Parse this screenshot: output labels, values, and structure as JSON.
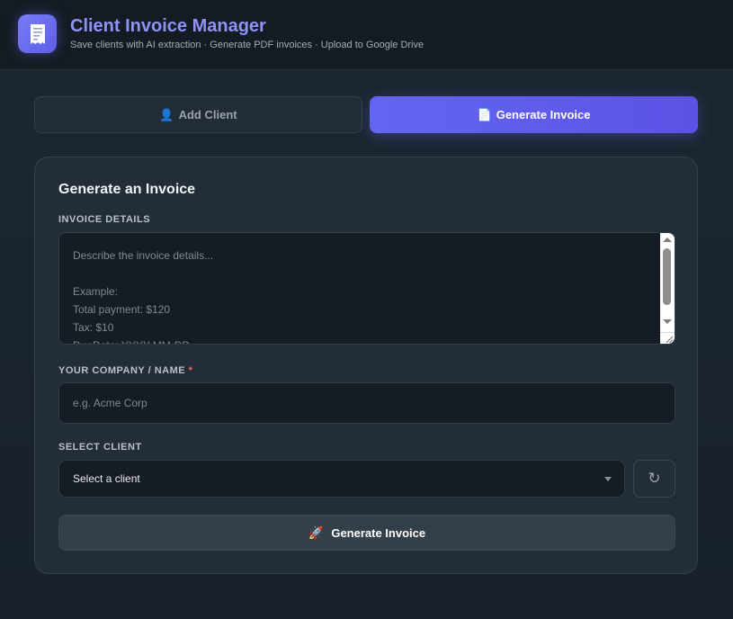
{
  "header": {
    "title": "Client Invoice Manager",
    "subtitle": "Save clients with AI extraction · Generate PDF invoices · Upload to Google Drive",
    "logo_icon": "receipt-icon"
  },
  "tabs": [
    {
      "label": "Add Client",
      "icon": "👤",
      "active": false
    },
    {
      "label": "Generate Invoice",
      "icon": "📄",
      "active": true
    }
  ],
  "form": {
    "title": "Generate an Invoice",
    "invoice_details_label": "INVOICE DETAILS",
    "invoice_details_placeholder_lines": [
      "Describe the invoice details...",
      "",
      "Example:",
      "Total payment: $120",
      "Tax: $10",
      "DueDate: YYYY-MM-DD"
    ],
    "company_label": "YOUR COMPANY / NAME",
    "required_marker": "*",
    "company_placeholder": "e.g. Acme Corp",
    "client_label": "SELECT CLIENT",
    "client_selected": "Select a client",
    "refresh_symbol": "↻",
    "submit_label": "Generate Invoice",
    "submit_icon": "🚀"
  },
  "colors": {
    "accent": "#6366f1",
    "title": "#8e93f5",
    "required": "#f26b6b"
  }
}
